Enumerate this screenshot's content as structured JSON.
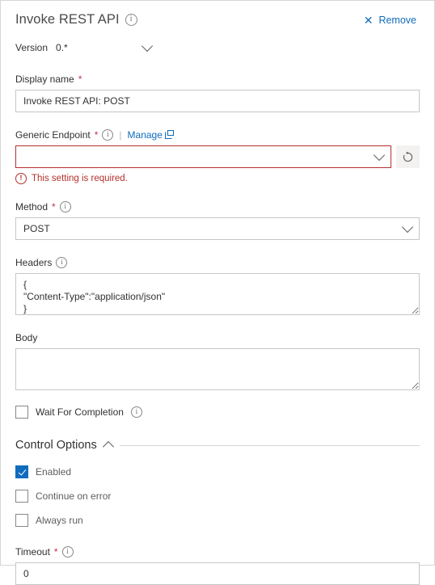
{
  "header": {
    "title": "Invoke REST API",
    "title_info_icon": "info-icon",
    "remove_label": "Remove",
    "remove_icon": "close-x-icon"
  },
  "version": {
    "label": "Version",
    "value": "0.*",
    "chevron_icon": "chevron-down-icon"
  },
  "fields": {
    "display_name": {
      "label": "Display name",
      "required_marker": "*",
      "value": "Invoke REST API: POST",
      "placeholder": ""
    },
    "generic_endpoint": {
      "label": "Generic Endpoint",
      "required_marker": "*",
      "info_icon": "info-icon",
      "separator": "|",
      "manage_label": "Manage",
      "manage_icon": "external-link-icon",
      "value": "",
      "placeholder": "",
      "chevron_icon": "chevron-down-icon",
      "refresh_icon": "refresh-icon",
      "error_message": "This setting is required.",
      "error_icon": "alert-circle-icon",
      "has_error": true
    },
    "method": {
      "label": "Method",
      "required_marker": "*",
      "info_icon": "info-icon",
      "value": "POST",
      "chevron_icon": "chevron-down-icon"
    },
    "headers": {
      "label": "Headers",
      "info_icon": "info-icon",
      "value": "{\n\"Content-Type\":\"application/json\"\n}",
      "placeholder": ""
    },
    "body": {
      "label": "Body",
      "value": "",
      "placeholder": ""
    },
    "wait_for_completion": {
      "label": "Wait For Completion",
      "info_icon": "info-icon",
      "checked": false
    },
    "timeout": {
      "label": "Timeout",
      "required_marker": "*",
      "info_icon": "info-icon",
      "value": "0",
      "placeholder": ""
    }
  },
  "control_options": {
    "title": "Control Options",
    "chevron_icon": "chevron-up-icon",
    "checkboxes": [
      {
        "label": "Enabled",
        "checked": true
      },
      {
        "label": "Continue on error",
        "checked": false
      },
      {
        "label": "Always run",
        "checked": false
      }
    ]
  },
  "colors": {
    "accent": "#0f6cbd",
    "error": "#b5302b",
    "required_star": "#c4314b",
    "border": "#c8c6c4",
    "panel_border": "#d6d6d6",
    "text": "#323130",
    "muted_text": "#605e5c",
    "button_bg": "#f3f2f1"
  }
}
